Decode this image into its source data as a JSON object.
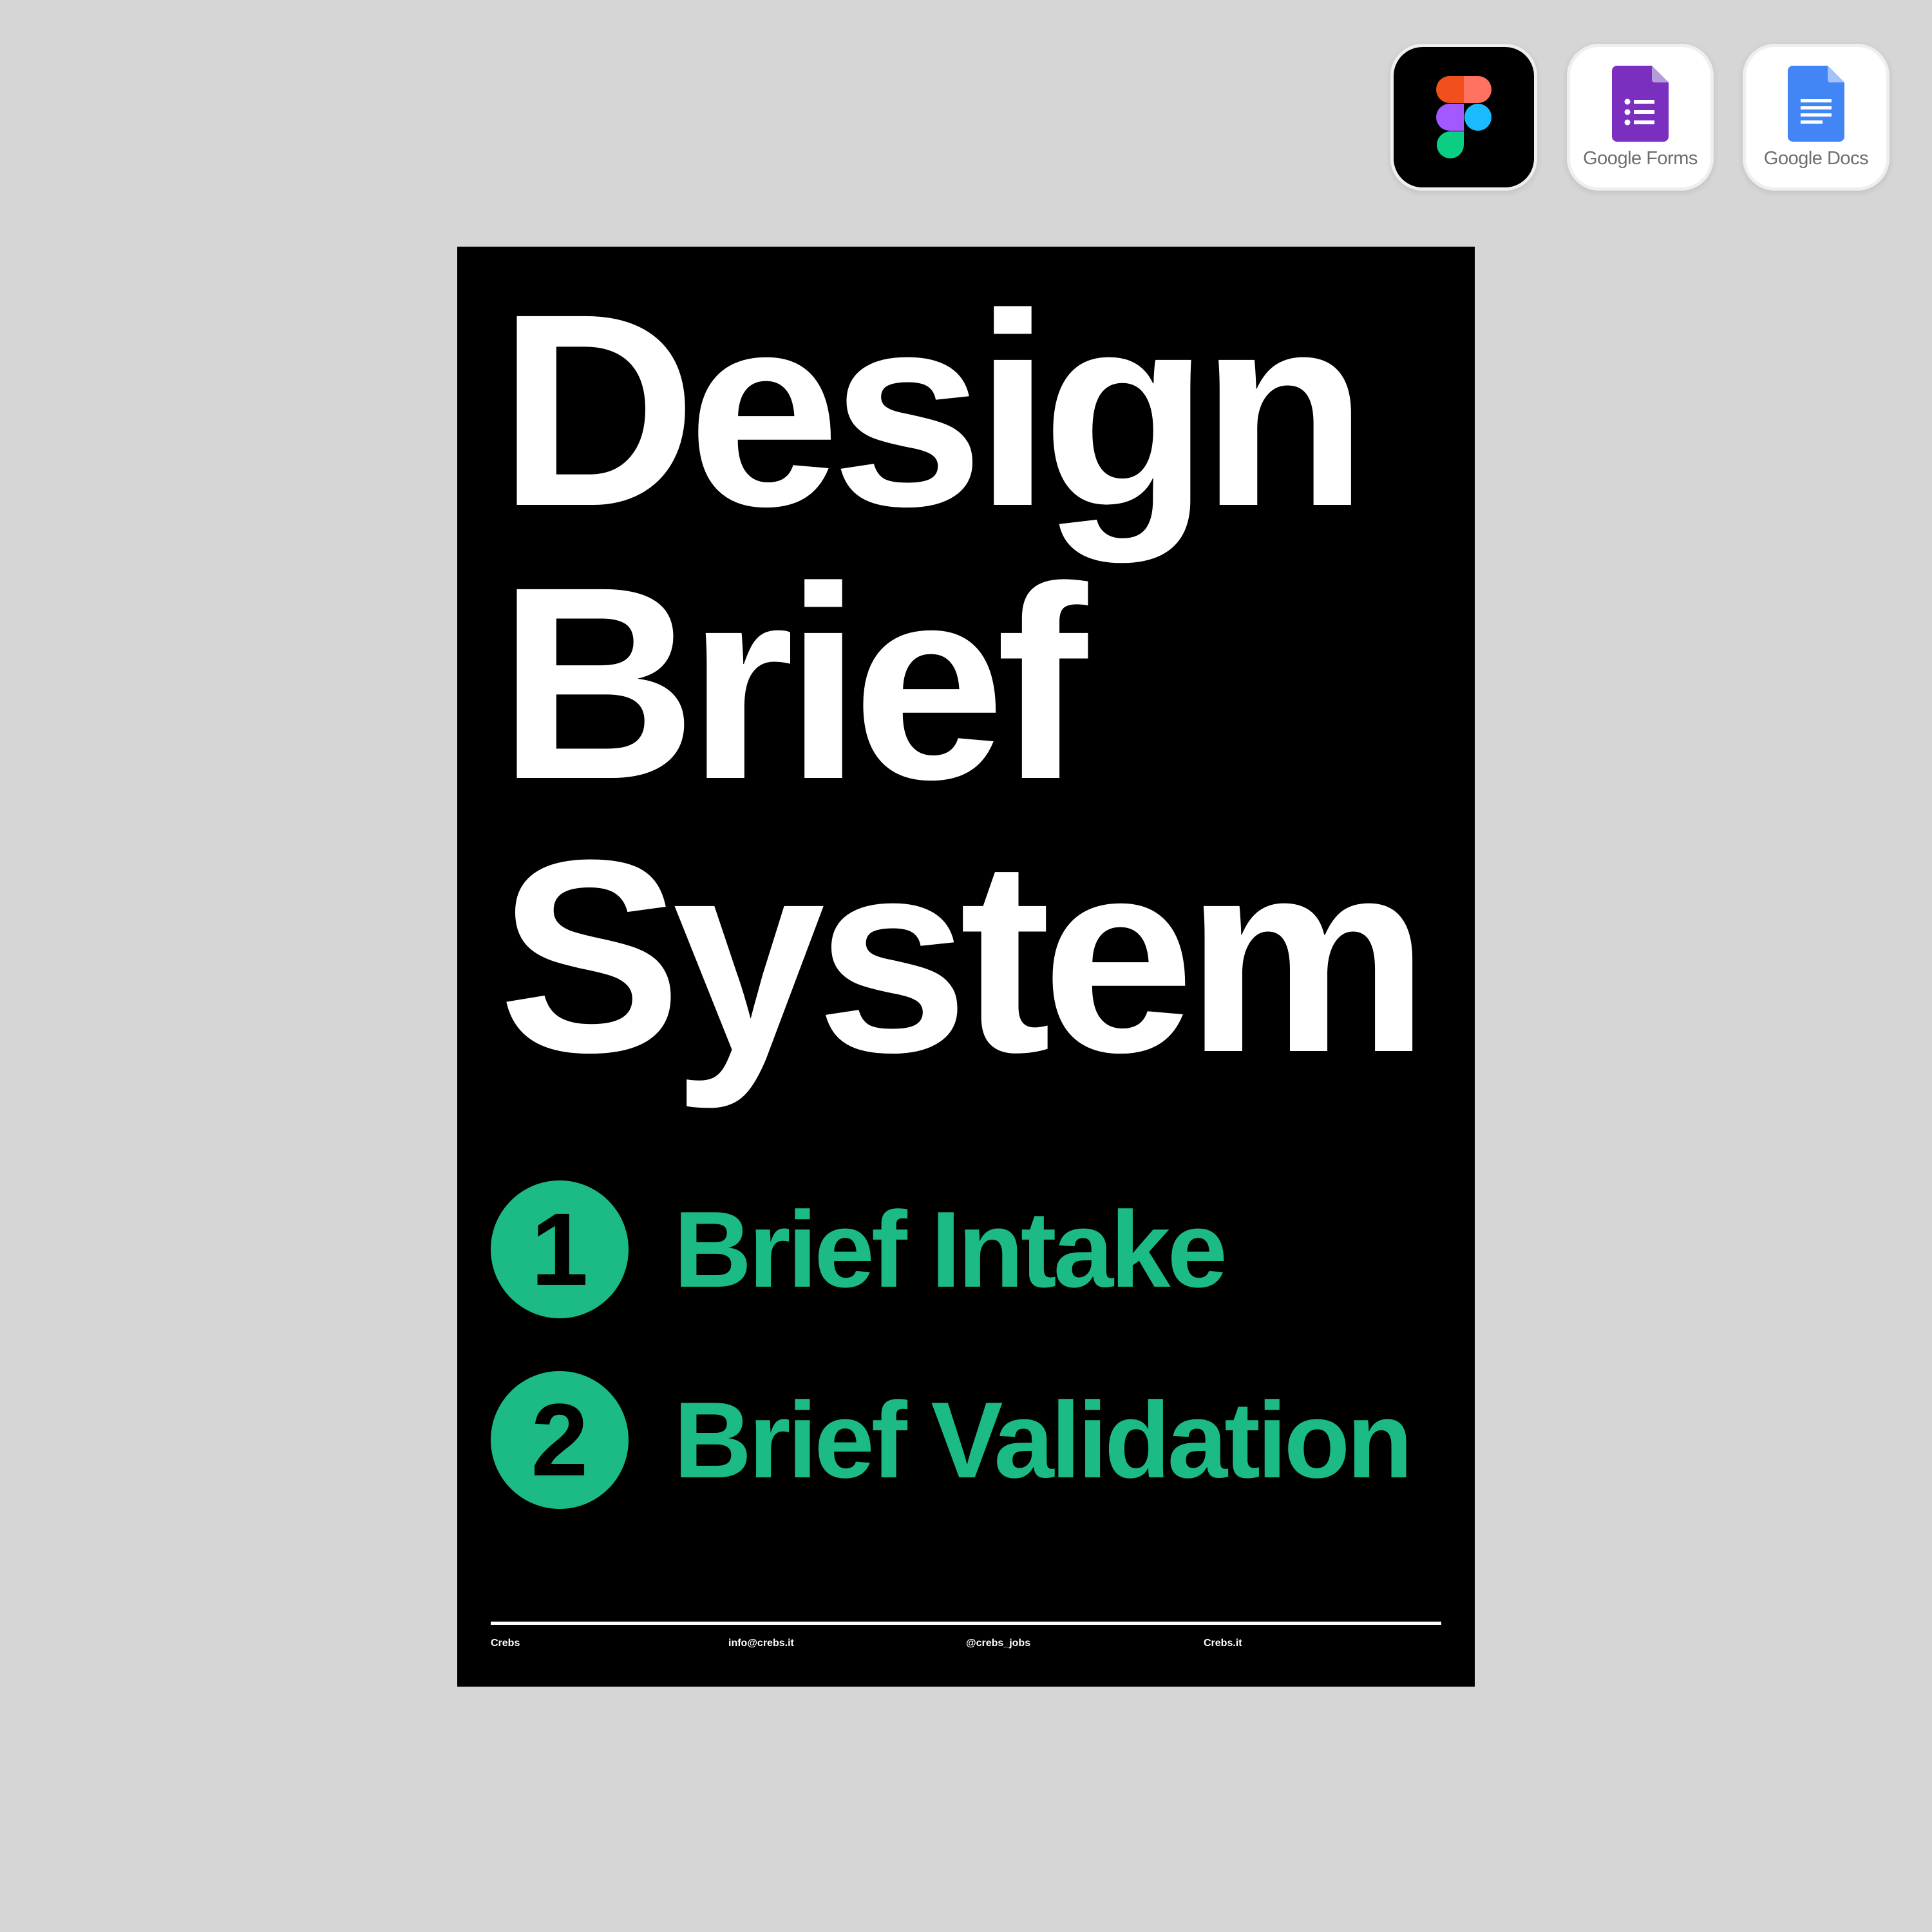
{
  "app_icons": [
    {
      "name": "figma-icon",
      "label": ""
    },
    {
      "name": "google-forms-icon",
      "label": "Google Forms"
    },
    {
      "name": "google-docs-icon",
      "label": "Google Docs"
    }
  ],
  "poster": {
    "title_lines": [
      "Design",
      "Brief",
      "System"
    ],
    "steps": [
      {
        "number": "1",
        "label": "Brief Intake"
      },
      {
        "number": "2",
        "label": "Brief Validation"
      }
    ],
    "footer": [
      "Crebs",
      "info@crebs.it",
      "@crebs_jobs",
      "Crebs.it"
    ]
  },
  "colors": {
    "background": "#d6d6d6",
    "poster": "#000000",
    "accent": "#1cbb85",
    "text": "#ffffff"
  }
}
